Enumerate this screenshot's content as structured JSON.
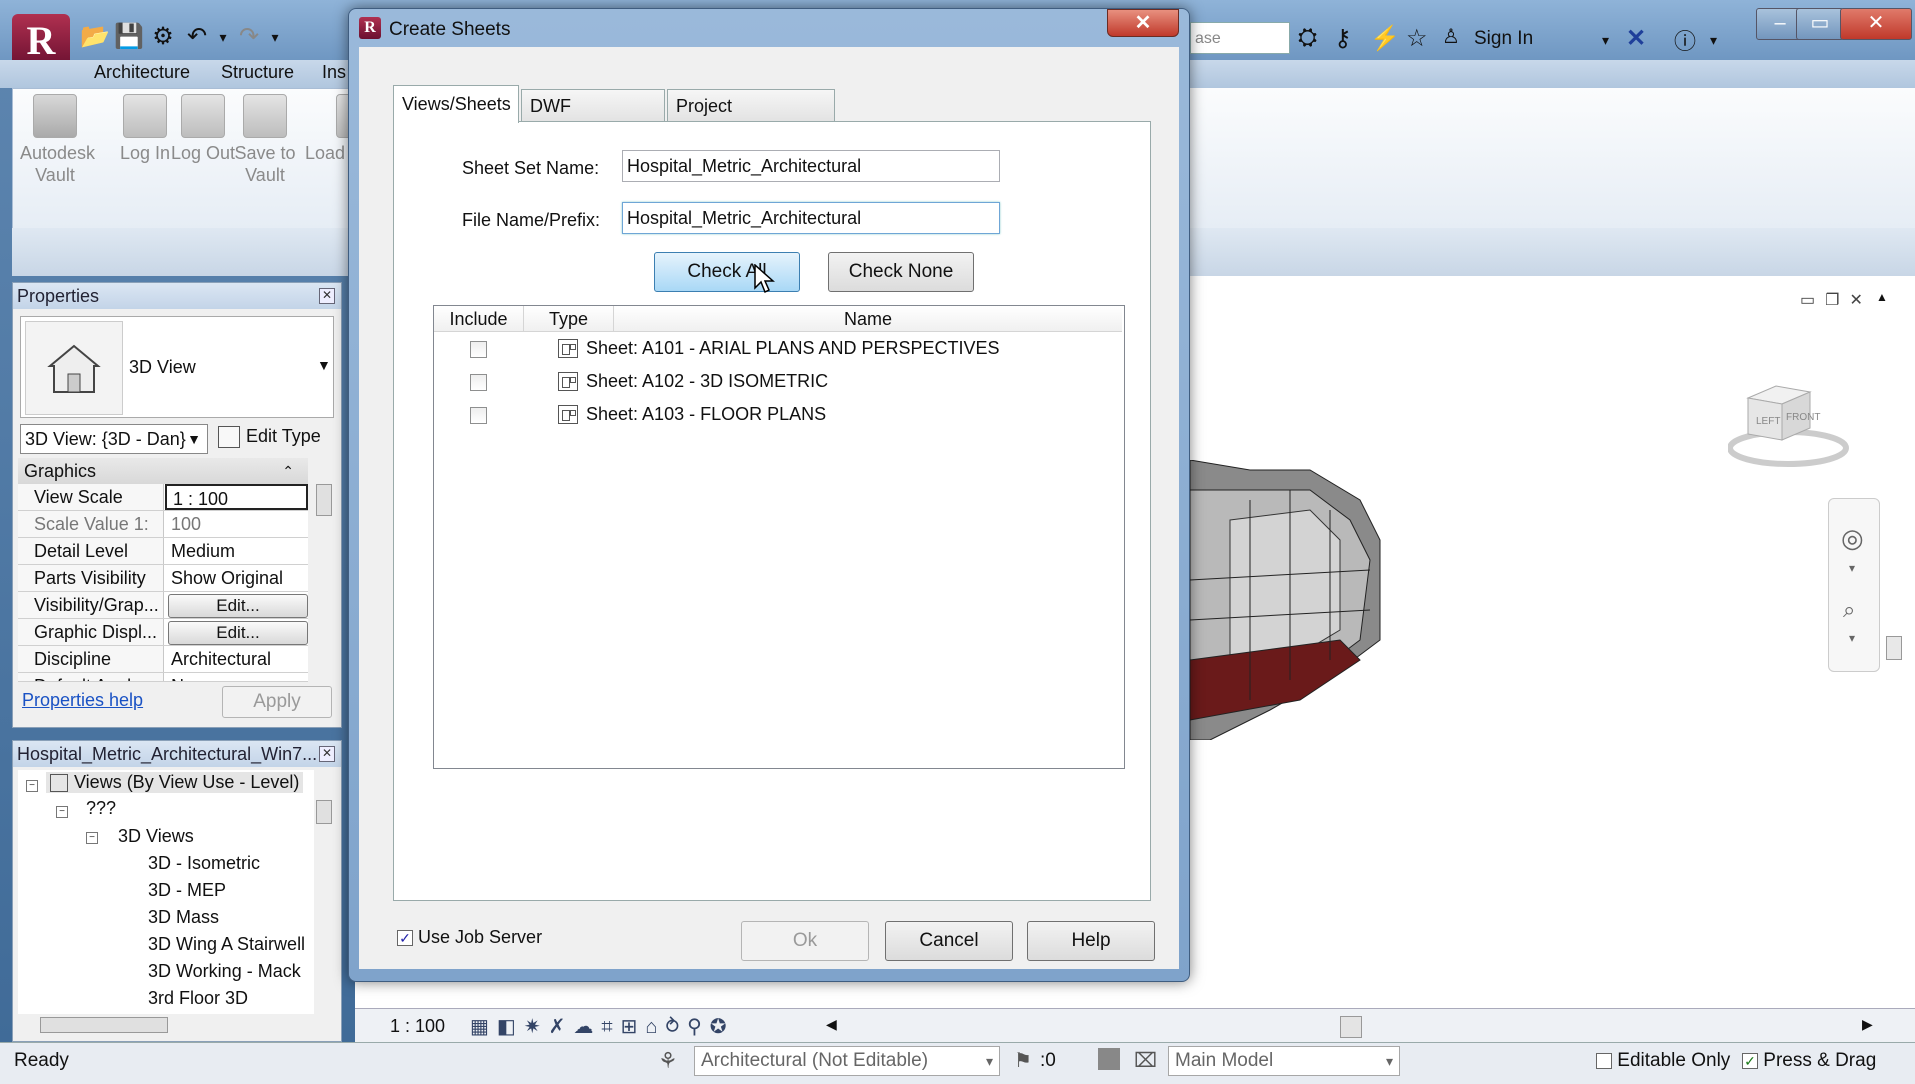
{
  "app": {
    "ribbon_tabs": [
      "Architecture",
      "Structure",
      "Ins"
    ],
    "ribbon_buttons": [
      "Autodesk Vault",
      "Log In",
      "Log Out",
      "Save to Vault",
      "Load"
    ],
    "search_placeholder": "ase",
    "sign_in": "Sign In",
    "window_controls": {
      "minimize": "–",
      "maximize": "▭",
      "close": "✕"
    }
  },
  "properties": {
    "title": "Properties",
    "type_name": "3D View",
    "instance_selector": "3D View: {3D - Dan}",
    "edit_type": "Edit Type",
    "section": "Graphics",
    "rows": [
      {
        "key": "View Scale",
        "value": "1 : 100"
      },
      {
        "key": "Scale Value    1:",
        "value": "100"
      },
      {
        "key": "Detail Level",
        "value": "Medium"
      },
      {
        "key": "Parts Visibility",
        "value": "Show Original"
      },
      {
        "key": "Visibility/Grap...",
        "value": "Edit..."
      },
      {
        "key": "Graphic Displ...",
        "value": "Edit..."
      },
      {
        "key": "Discipline",
        "value": "Architectural"
      },
      {
        "key": "Default Analy...",
        "value": "N..."
      }
    ],
    "help_link": "Properties help",
    "apply": "Apply"
  },
  "browser": {
    "title": "Hospital_Metric_Architectural_Win7...",
    "items": [
      {
        "label": "Views (By View Use - Level)",
        "depth": 0
      },
      {
        "label": "???",
        "depth": 1
      },
      {
        "label": "3D Views",
        "depth": 2
      },
      {
        "label": "3D - Isometric",
        "depth": 3
      },
      {
        "label": "3D - MEP",
        "depth": 3
      },
      {
        "label": "3D Mass",
        "depth": 3
      },
      {
        "label": "3D Wing A Stairwell",
        "depth": 3
      },
      {
        "label": "3D Working - Mack",
        "depth": 3
      },
      {
        "label": "3rd Floor 3D",
        "depth": 3
      }
    ]
  },
  "dialog": {
    "title": "Create Sheets",
    "close": "✕",
    "tabs": [
      "Views/Sheets",
      "DWF properties",
      "Project Information"
    ],
    "sheet_set_label": "Sheet Set Name:",
    "sheet_set_value": "Hospital_Metric_Architectural",
    "file_prefix_label": "File Name/Prefix:",
    "file_prefix_value": "Hospital_Metric_Architectural",
    "check_all": "Check All",
    "check_none": "Check None",
    "columns": [
      "Include",
      "Type",
      "Name"
    ],
    "rows": [
      {
        "name": "Sheet: A101 - ARIAL PLANS AND PERSPECTIVES",
        "included": false
      },
      {
        "name": "Sheet: A102 - 3D ISOMETRIC",
        "included": false
      },
      {
        "name": "Sheet: A103 - FLOOR PLANS",
        "included": false
      }
    ],
    "use_job_server": "Use Job Server",
    "use_job_server_checked": true,
    "ok": "Ok",
    "cancel": "Cancel",
    "help": "Help"
  },
  "viewcube": {
    "left": "LEFT",
    "front": "FRONT"
  },
  "viewbar": {
    "scale": "1 : 100"
  },
  "status": {
    "text": "Ready",
    "workset": "Architectural (Not Editable)",
    "count": ":0",
    "model": "Main Model",
    "editable_only": "Editable Only",
    "press_drag": "Press & Drag"
  }
}
